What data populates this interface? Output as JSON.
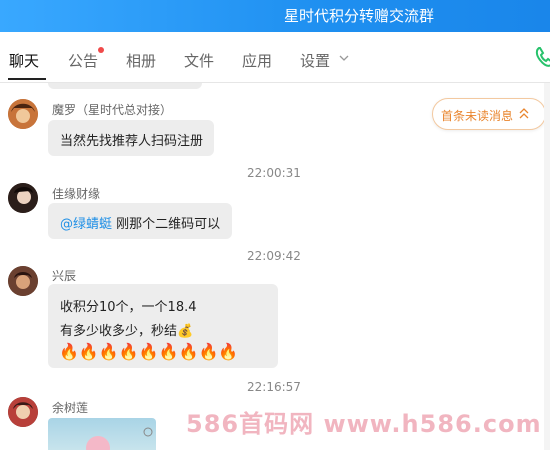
{
  "window": {
    "title": "星时代积分转赠交流群"
  },
  "tabs": [
    {
      "label": "聊天"
    },
    {
      "label": "公告"
    },
    {
      "label": "相册"
    },
    {
      "label": "文件"
    },
    {
      "label": "应用"
    },
    {
      "label": "设置"
    }
  ],
  "unread": {
    "label": "首条未读消息"
  },
  "messages": [
    {
      "sender": "魔罗（星时代总对接）",
      "lines": [
        "当然先找推荐人扫码注册"
      ]
    },
    {
      "time": "22:00:31"
    },
    {
      "sender": "佳缘财缘",
      "mention": "@绿蜻蜓",
      "text": " 刚那个二维码可以"
    },
    {
      "time": "22:09:42"
    },
    {
      "sender": "兴辰",
      "lines": [
        "收积分10个，一个18.4",
        "有多少收多少，秒结"
      ],
      "emoji": "💰",
      "fires": "🔥🔥🔥🔥🔥🔥🔥🔥🔥"
    },
    {
      "time": "22:16:57"
    },
    {
      "sender": "余树莲"
    }
  ],
  "watermark": {
    "text": "586首码网  www.h586.com"
  },
  "colors": {
    "accent": "#1e8ff0",
    "unread": "#e9852e",
    "bubble": "#ededed"
  }
}
